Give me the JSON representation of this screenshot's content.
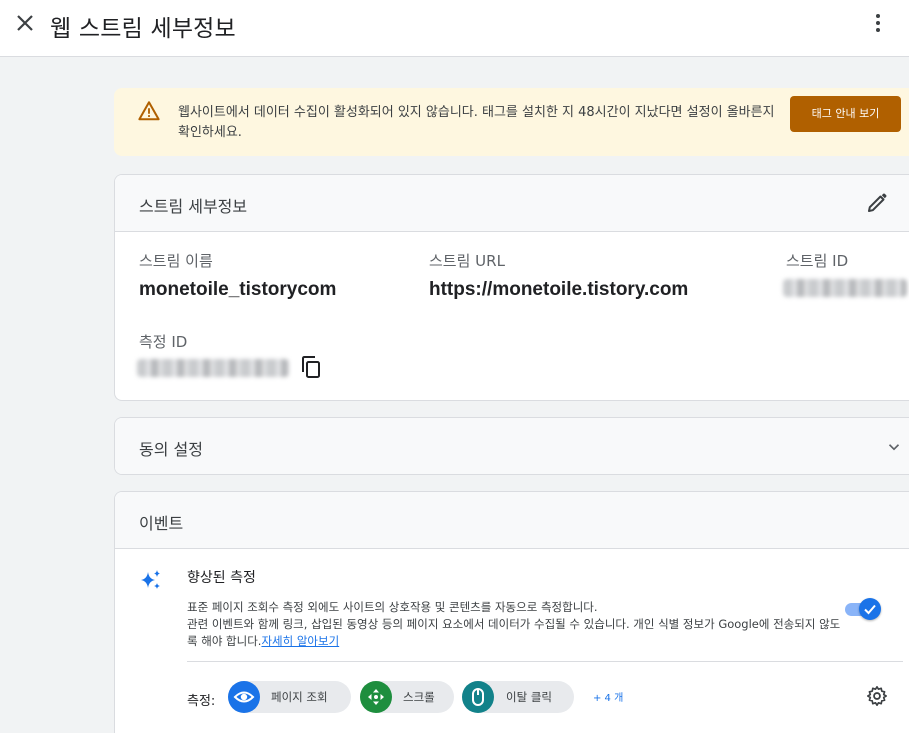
{
  "header": {
    "title": "웹 스트림 세부정보",
    "close_icon": "close-icon",
    "more_icon": "more-vert-icon"
  },
  "alert": {
    "icon": "warning-icon",
    "text": "웹사이트에서 데이터 수집이 활성화되어 있지 않습니다. 태그를 설치한 지 48시간이 지났다면 설정이 올바른지 확인하세요.",
    "button_label": "태그 안내 보기",
    "button_color": "#b06000",
    "background": "#fef7e0"
  },
  "stream_details": {
    "title": "스트림 세부정보",
    "edit_icon": "edit-icon",
    "fields": {
      "name_label": "스트림 이름",
      "name_value": "monetoile_tistorycom",
      "url_label": "스트림 URL",
      "url_value": "https://monetoile.tistory.com",
      "id_label": "스트림 ID",
      "measurement_id_label": "측정 ID"
    },
    "copy_icon": "copy-icon"
  },
  "consent": {
    "title": "동의 설정",
    "chevron_icon": "chevron-down-icon"
  },
  "events": {
    "title": "이벤트",
    "enhanced": {
      "icon": "sparkle-icon",
      "title": "향상된 측정",
      "description_line1": "표준 페이지 조회수 측정 외에도 사이트의 상호작용 및 콘텐츠를 자동으로 측정합니다.",
      "description_line2": "관련 이벤트와 함께 링크, 삽입된 동영상 등의 페이지 요소에서 데이터가 수집될 수 있습니다. 개인 식별 정보가 Google에 전송되지 않도록 해야 합니다.",
      "learn_more": "자세히 알아보기",
      "toggle_on": true
    },
    "measurement_label": "측정:",
    "chips": [
      {
        "label": "페이지 조회",
        "icon": "eye-icon",
        "color": "#1a73e8"
      },
      {
        "label": "스크롤",
        "icon": "scroll-arrows-icon",
        "color": "#1e8e3e"
      },
      {
        "label": "이탈 클릭",
        "icon": "mouse-icon",
        "color": "#12828a"
      }
    ],
    "more_label": "+ 4 개",
    "settings_icon": "gear-icon"
  }
}
